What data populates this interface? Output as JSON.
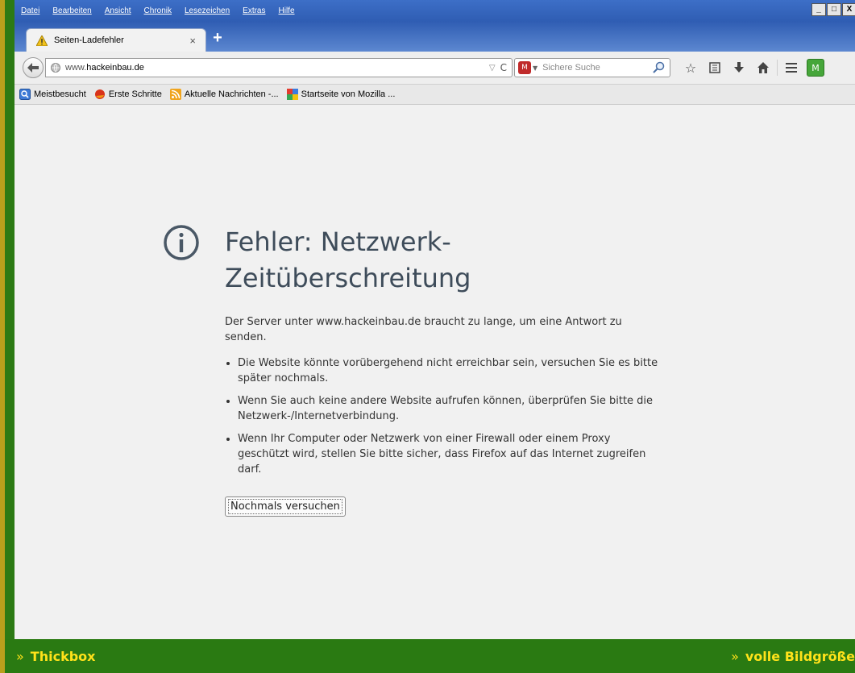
{
  "menubar": {
    "items": [
      "Datei",
      "Bearbeiten",
      "Ansicht",
      "Chronik",
      "Lesezeichen",
      "Extras",
      "Hilfe"
    ]
  },
  "window_controls": {
    "minimize": "_",
    "maximize": "□",
    "close": "X"
  },
  "tab": {
    "title": "Seiten-Ladefehler",
    "close_glyph": "×",
    "new_tab_glyph": "+"
  },
  "navbar": {
    "url_prefix": "www.",
    "url_domain": "hackeinbau.de",
    "search_placeholder": "Sichere Suche"
  },
  "bookmarks": {
    "items": [
      {
        "label": "Meistbesucht",
        "icon": "most-visited-icon"
      },
      {
        "label": "Erste Schritte",
        "icon": "firefox-icon"
      },
      {
        "label": "Aktuelle Nachrichten -...",
        "icon": "rss-icon"
      },
      {
        "label": "Startseite von Mozilla ...",
        "icon": "mozilla-icon"
      }
    ]
  },
  "error": {
    "title": "Fehler: Netzwerk-Zeitüberschreitung",
    "description": "Der Server unter www.hackeinbau.de braucht zu lange, um eine Antwort zu senden.",
    "bullets": [
      "Die Website könnte vorübergehend nicht erreichbar sein, versuchen Sie es bitte später nochmals.",
      "Wenn Sie auch keine andere Website aufrufen können, überprüfen Sie bitte die Netzwerk-/Internetverbindung.",
      "Wenn Ihr Computer oder Netzwerk von einer Firewall oder einem Proxy geschützt wird, stellen Sie bitte sicher, dass Firefox auf das Internet zugreifen darf."
    ],
    "retry_label": "Nochmals versuchen"
  },
  "bottom": {
    "arrow": "»",
    "left_label": "Thickbox",
    "right_label": "volle Bildgröße"
  },
  "colors": {
    "bottom_bar": "#2a7a12",
    "bottom_text": "#ffe21a",
    "titlebar": "#2f5db3",
    "content_bg": "#f1f1f1",
    "error_title": "#3e4c5a"
  }
}
